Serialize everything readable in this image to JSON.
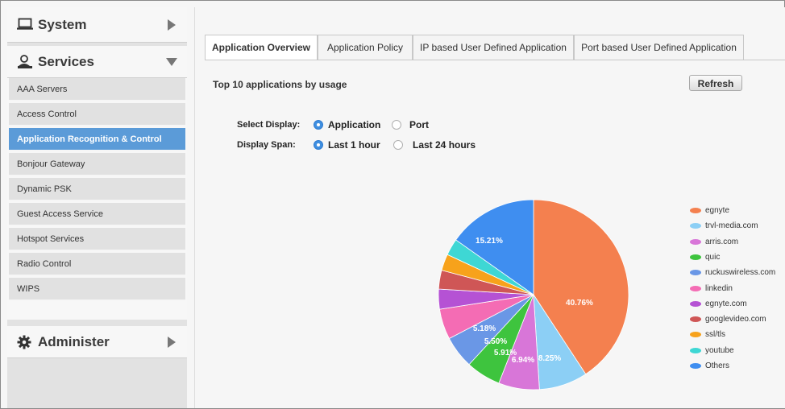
{
  "sidebar": {
    "system_label": "System",
    "services_label": "Services",
    "administer_label": "Administer",
    "items": [
      {
        "label": "AAA Servers",
        "active": false
      },
      {
        "label": "Access Control",
        "active": false
      },
      {
        "label": "Application Recognition & Control",
        "active": true
      },
      {
        "label": "Bonjour Gateway",
        "active": false
      },
      {
        "label": "Dynamic PSK",
        "active": false
      },
      {
        "label": "Guest Access Service",
        "active": false
      },
      {
        "label": "Hotspot Services",
        "active": false
      },
      {
        "label": "Radio Control",
        "active": false
      },
      {
        "label": "WIPS",
        "active": false
      }
    ]
  },
  "tabs": [
    {
      "label": "Application Overview",
      "active": true
    },
    {
      "label": "Application Policy",
      "active": false
    },
    {
      "label": "IP based User Defined Application",
      "active": false
    },
    {
      "label": "Port based User Defined Application",
      "active": false
    }
  ],
  "main": {
    "heading": "Top 10 applications by usage",
    "refresh_label": "Refresh",
    "select_display_label": "Select Display:",
    "display_options": [
      {
        "label": "Application",
        "selected": true
      },
      {
        "label": "Port",
        "selected": false
      }
    ],
    "display_span_label": "Display Span:",
    "span_options": [
      {
        "label": "Last 1 hour",
        "selected": true
      },
      {
        "label": "Last 24 hours",
        "selected": false
      }
    ]
  },
  "chart_data": {
    "type": "pie",
    "series": [
      {
        "name": "egnyte",
        "value": 40.76,
        "label": "40.76%",
        "color": "#f4804f"
      },
      {
        "name": "trvl-media.com",
        "value": 8.25,
        "label": "8.25%",
        "color": "#8ccff5"
      },
      {
        "name": "arris.com",
        "value": 6.94,
        "label": "6.94%",
        "color": "#d876d8"
      },
      {
        "name": "quic",
        "value": 5.91,
        "label": "5.91%",
        "color": "#3ec43e"
      },
      {
        "name": "ruckuswireless.com",
        "value": 5.5,
        "label": "5.50%",
        "color": "#6a97e6"
      },
      {
        "name": "linkedin",
        "value": 5.18,
        "label": "5.18%",
        "color": "#f46cb4"
      },
      {
        "name": "egnyte.com",
        "value": 3.4,
        "label": "",
        "color": "#b552d4"
      },
      {
        "name": "googlevideo.com",
        "value": 3.2,
        "label": "",
        "color": "#cf5656"
      },
      {
        "name": "ssl/tls",
        "value": 2.8,
        "label": "",
        "color": "#f7a21b"
      },
      {
        "name": "youtube",
        "value": 2.85,
        "label": "",
        "color": "#3ed7d4"
      },
      {
        "name": "Others",
        "value": 15.21,
        "label": "15.21%",
        "color": "#3f8ef0"
      }
    ],
    "legend_position": "right"
  }
}
